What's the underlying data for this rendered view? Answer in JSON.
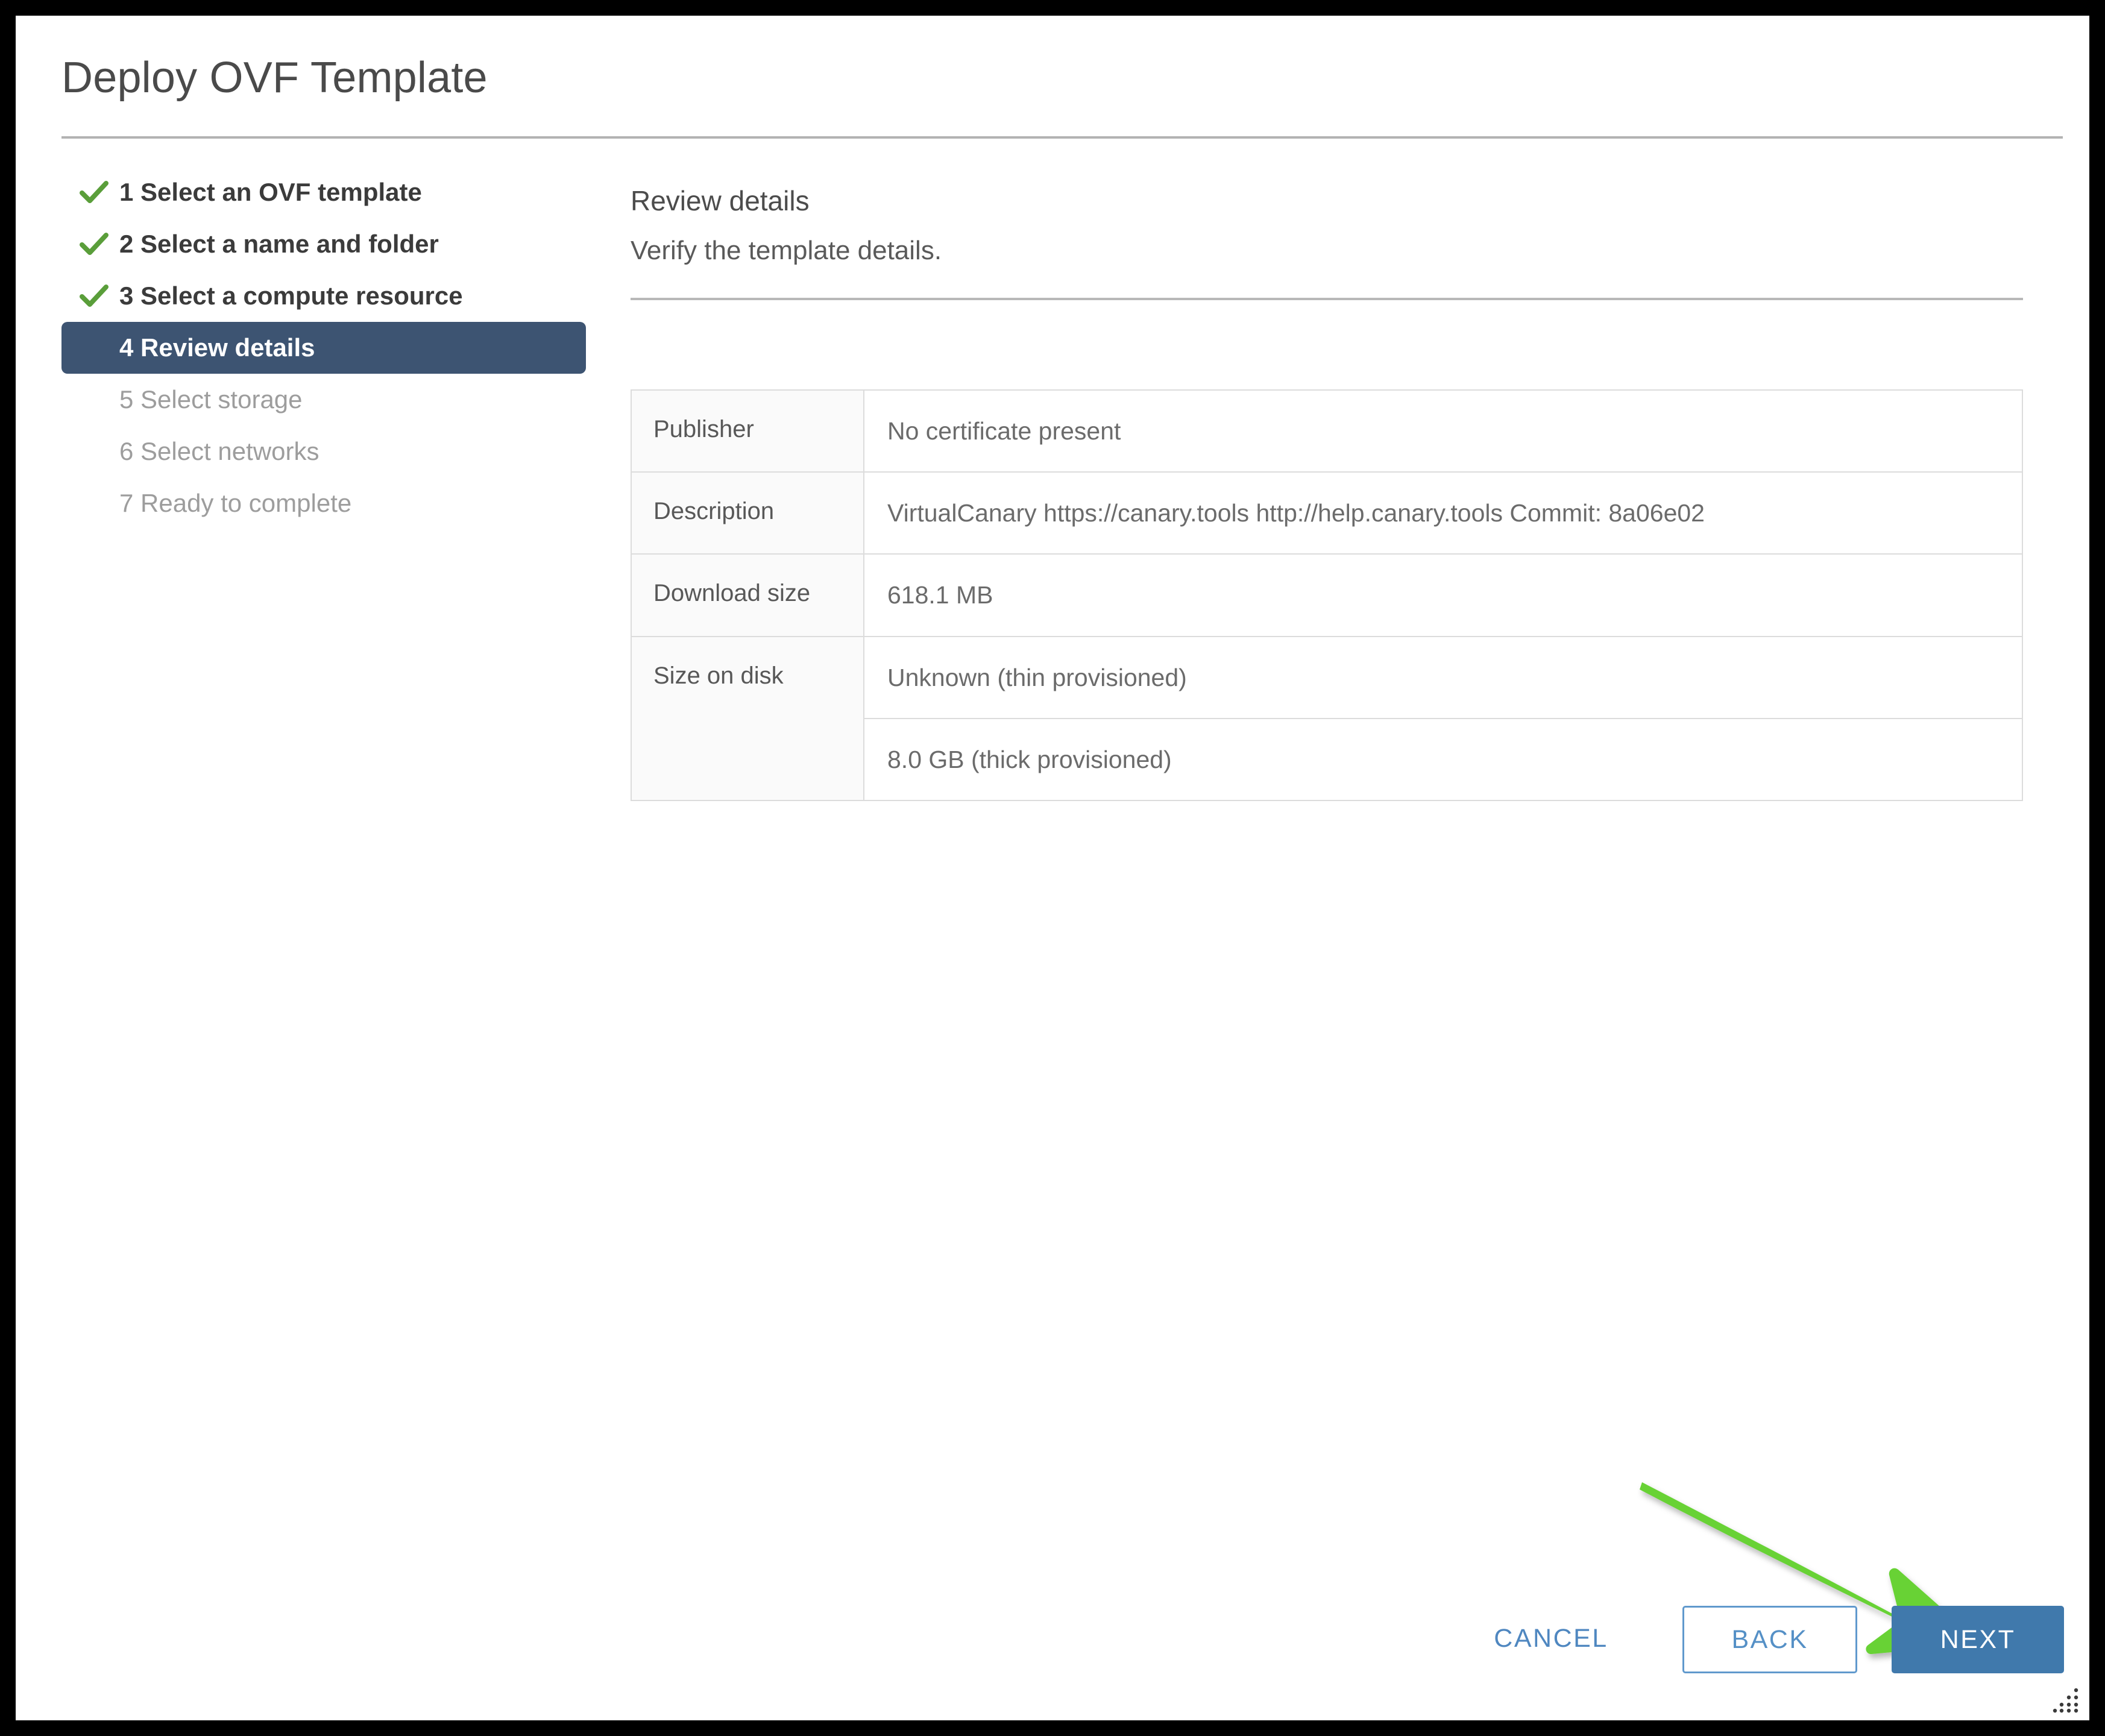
{
  "window": {
    "title": "Deploy OVF Template"
  },
  "steps": [
    {
      "number": "1",
      "label": "1 Select an OVF template",
      "state": "done"
    },
    {
      "number": "2",
      "label": "2 Select a name and folder",
      "state": "done"
    },
    {
      "number": "3",
      "label": "3 Select a compute resource",
      "state": "done"
    },
    {
      "number": "4",
      "label": "4 Review details",
      "state": "active"
    },
    {
      "number": "5",
      "label": "5 Select storage",
      "state": "pending"
    },
    {
      "number": "6",
      "label": "6 Select networks",
      "state": "pending"
    },
    {
      "number": "7",
      "label": "7 Ready to complete",
      "state": "pending"
    }
  ],
  "pane": {
    "title": "Review details",
    "subtitle": "Verify the template details."
  },
  "details": {
    "publisher": {
      "label": "Publisher",
      "value": "No certificate present"
    },
    "description": {
      "label": "Description",
      "value": "VirtualCanary https://canary.tools http://help.canary.tools Commit: 8a06e02"
    },
    "download_size": {
      "label": "Download size",
      "value": "618.1 MB"
    },
    "size_on_disk": {
      "label": "Size on disk",
      "value_thin": "Unknown (thin provisioned)",
      "value_thick": "8.0 GB (thick provisioned)"
    }
  },
  "footer": {
    "cancel_label": "CANCEL",
    "back_label": "BACK",
    "next_label": "NEXT"
  },
  "icons": {
    "checkmark": "check-icon",
    "arrow": "green-annotation-arrow-icon",
    "grip": "resize-grip-icon"
  },
  "colors": {
    "active_step_bg": "#3d5472",
    "checkmark_green": "#5a9e3a",
    "primary_button_bg": "#4079ac",
    "link_blue": "#4f87c0",
    "annotation_green": "#67d235",
    "frame_black": "#000000"
  }
}
